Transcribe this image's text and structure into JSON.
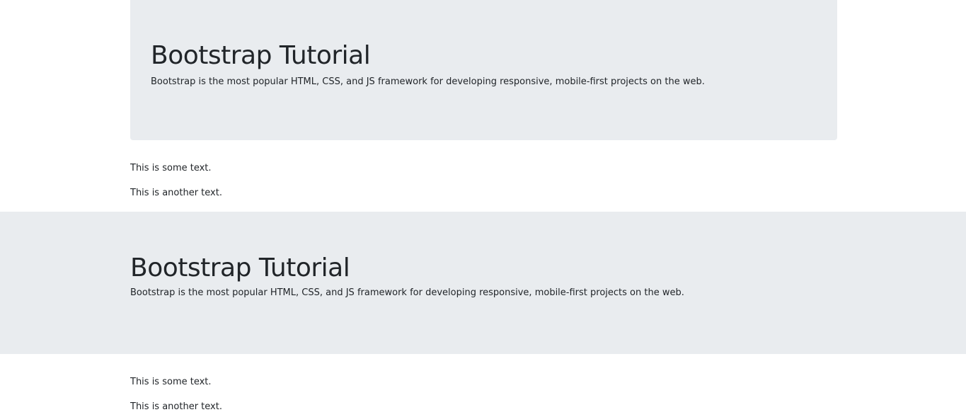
{
  "section1": {
    "heading": "Bootstrap Tutorial",
    "lead": "Bootstrap is the most popular HTML, CSS, and JS framework for developing responsive, mobile-first projects on the web.",
    "paragraphs": [
      "This is some text.",
      "This is another text."
    ]
  },
  "section2": {
    "heading": "Bootstrap Tutorial",
    "lead": "Bootstrap is the most popular HTML, CSS, and JS framework for developing responsive, mobile-first projects on the web.",
    "paragraphs": [
      "This is some text.",
      "This is another text."
    ]
  },
  "colors": {
    "jumbotron_bg": "#e9ecef",
    "text": "#212529",
    "page_bg": "#ffffff"
  }
}
